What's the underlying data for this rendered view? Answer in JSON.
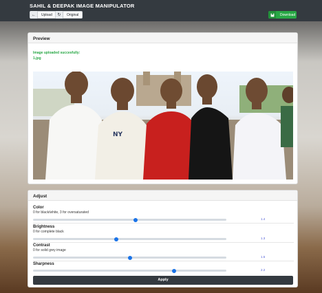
{
  "navbar": {
    "title": "SAHIL & DEEPAK IMAGE MANIPULATOR",
    "upload_label": "Upload",
    "upload_icon": "arrow-left-icon",
    "original_label": "Original",
    "original_icon": "refresh-icon",
    "download_label": "Download",
    "download_icon": "save-icon"
  },
  "preview": {
    "header": "Preview",
    "status_text": "Image uploaded succesfully:",
    "filename": "1.jpg"
  },
  "adjust": {
    "header": "Adjust",
    "controls": [
      {
        "label": "Color",
        "hint": "0 for black/white, 3 for oversaturated",
        "value": "1.4",
        "fraction": 0.53
      },
      {
        "label": "Brightness",
        "hint": "0 for complete black",
        "value": "1.3",
        "fraction": 0.43
      },
      {
        "label": "Contrast",
        "hint": "0 for solid grey image",
        "value": "1.5",
        "fraction": 0.5
      },
      {
        "label": "Sharpness",
        "hint": "",
        "value": "2.2",
        "fraction": 0.73
      }
    ],
    "apply_label": "Apply"
  },
  "colors": {
    "navbar": "#343a40",
    "success": "#28a745",
    "accent": "#1a73e8"
  }
}
